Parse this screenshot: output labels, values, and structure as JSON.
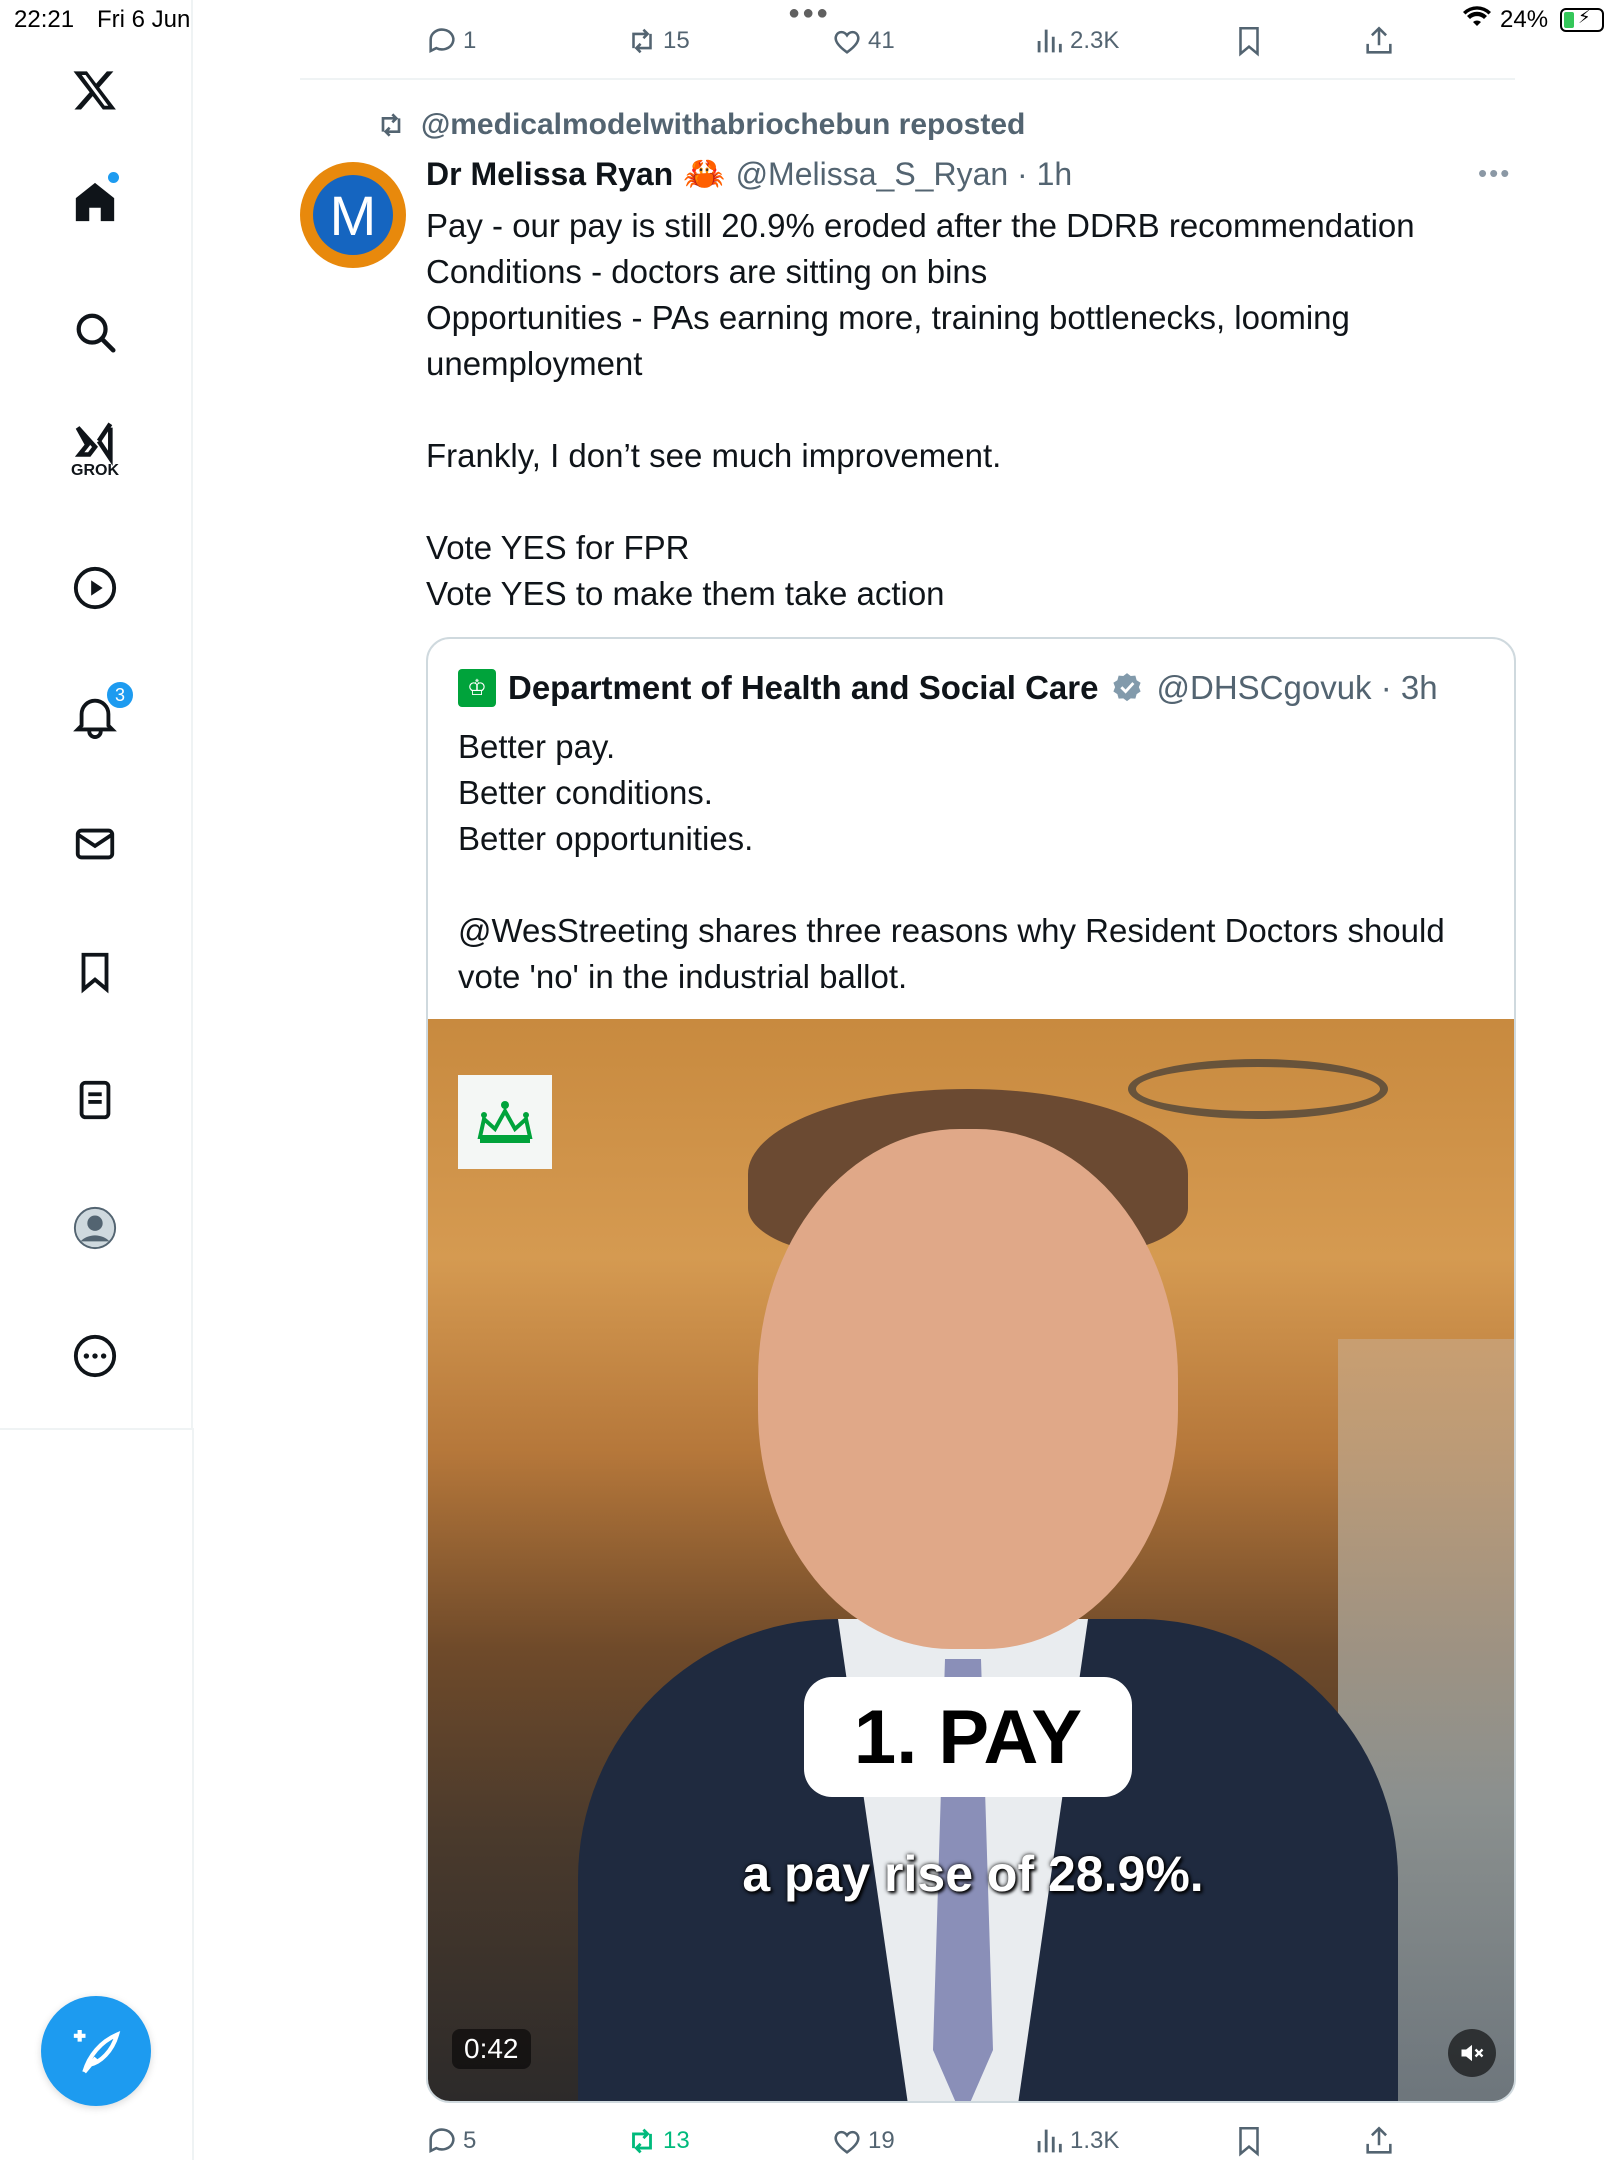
{
  "status_bar": {
    "time": "22:21",
    "date": "Fri 6 Jun",
    "battery": "24%"
  },
  "sidebar": {
    "grok_label": "GROK",
    "notifications_count": "3"
  },
  "previous_post_actions": {
    "replies": "1",
    "reposts": "15",
    "likes": "41",
    "views": "2.3K"
  },
  "repost_line": "@medicalmodelwithabriochebun reposted",
  "post": {
    "avatar_letter": "M",
    "author_name": "Dr Melissa Ryan",
    "author_emoji": "🦀",
    "handle_time": "@Melissa_S_Ryan · 1h",
    "body_lines": [
      "Pay - our pay is still 20.9% eroded after the DDRB recommendation",
      "Conditions - doctors are sitting on bins",
      "Opportunities - PAs earning more, training bottlenecks, looming",
      "unemployment",
      "",
      "Frankly, I don’t see much improvement.",
      "",
      "Vote YES for FPR",
      "Vote YES to make them take action"
    ],
    "actions": {
      "replies": "5",
      "reposts": "13",
      "likes": "19",
      "views": "1.3K"
    }
  },
  "quote": {
    "author_name": "Department of Health and Social Care",
    "handle_time": "@DHSCgovuk · 3h",
    "body_lines": [
      "Better pay.",
      "Better conditions.",
      "Better opportunities.",
      "",
      "@WesStreeting shares three reasons why Resident Doctors should",
      "vote 'no' in the industrial ballot."
    ],
    "video": {
      "caption": "1. PAY",
      "subtitle": "a pay rise of 28.9%.",
      "duration": "0:42"
    }
  },
  "colors": {
    "accent": "#1d9bf0",
    "repost_green": "#00ba7c",
    "muted_text": "#536471",
    "gov_green": "#00a33b"
  }
}
